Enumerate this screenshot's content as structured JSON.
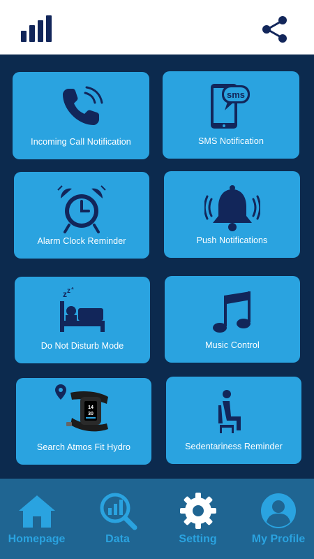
{
  "header": {
    "signal_icon": "signal-bars-icon",
    "share_icon": "share-icon"
  },
  "tiles": [
    {
      "label": "Incoming Call Notification",
      "icon": "phone-ringing-icon"
    },
    {
      "label": "SMS Notification",
      "icon": "sms-phone-icon"
    },
    {
      "label": "Alarm Clock Reminder",
      "icon": "alarm-clock-icon"
    },
    {
      "label": "Push Notifications",
      "icon": "bell-icon"
    },
    {
      "label": "Do Not Disturb Mode",
      "icon": "sleeping-bed-icon"
    },
    {
      "label": "Music Control",
      "icon": "music-note-icon"
    },
    {
      "label": "Search Atmos Fit Hydro",
      "icon": "fitness-band-icon"
    },
    {
      "label": "Sedentariness Reminder",
      "icon": "sitting-person-icon"
    }
  ],
  "sms_badge_text": "sms",
  "band_screen_text": "14\n30",
  "nav": [
    {
      "label": "Homepage",
      "icon": "home-icon"
    },
    {
      "label": "Data",
      "icon": "chart-search-icon"
    },
    {
      "label": "Setting",
      "icon": "gear-icon"
    },
    {
      "label": "My Profile",
      "icon": "profile-icon"
    }
  ],
  "colors": {
    "background": "#0c2a4e",
    "tile": "#2aa3e0",
    "icon": "#12265a",
    "nav_bar": "#1f6592",
    "nav_text": "#2aa3e0"
  }
}
